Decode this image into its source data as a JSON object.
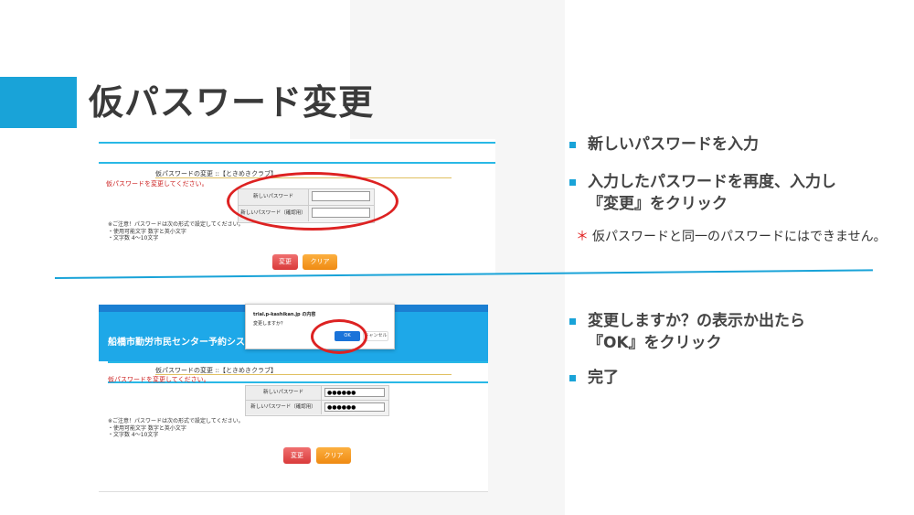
{
  "slide": {
    "title": "仮パスワード変更",
    "colors": {
      "accent": "#19a3d8",
      "ellipse": "#d22222"
    }
  },
  "screenshot1": {
    "form_title": "仮パスワードの変更 ::【ときめきクラブ】",
    "warning": "仮パスワードを変更してください。",
    "rows": [
      {
        "label": "新しいパスワード",
        "value": ""
      },
      {
        "label": "新しいパスワード（確認用）",
        "value": ""
      }
    ],
    "notes": [
      "※ご注意！パスワードは次の形式で設定してください。",
      "・使用可能文字 数字と英小文字",
      "・文字数 4〜10文字"
    ],
    "change_button": "変更",
    "clear_button": "クリア"
  },
  "screenshot2": {
    "banner": "船橋市勤労市民センター予約システム",
    "dialog": {
      "title": "trial.p-kashikan.jp の内容",
      "message": "変更しますか？",
      "ok": "OK",
      "cancel": "キャンセル"
    },
    "form_title": "仮パスワードの変更 ::【ときめきクラブ】",
    "warning": "仮パスワードを変更してください。",
    "rows": [
      {
        "label": "新しいパスワード",
        "value": "●●●●●●"
      },
      {
        "label": "新しいパスワード（確認用）",
        "value": "●●●●●●"
      }
    ],
    "notes": [
      "※ご注意！パスワードは次の形式で設定してください。",
      "・使用可能文字 数字と英小文字",
      "・文字数 4〜10文字"
    ],
    "change_button": "変更",
    "clear_button": "クリア"
  },
  "bullets": {
    "b1": "新しいパスワードを入力",
    "b2_line1": "入力したパスワードを再度、入力し",
    "b2_line2": "『変更』をクリック",
    "note_mark": "＊",
    "note": "仮パスワードと同一のパスワードにはできません。",
    "b3_line1": "変更しますか？の表示か出たら",
    "b3_line2": "『OK』をクリック",
    "b4": "完了"
  }
}
